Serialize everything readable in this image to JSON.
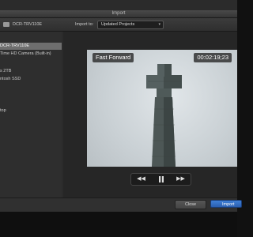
{
  "window": {
    "title": "Import"
  },
  "topbar": {
    "device_name": "DCR-TRV110E",
    "import_to_label": "Import to:",
    "import_to_value": "Updated Projects"
  },
  "sidebar": {
    "items": [
      {
        "label": "DCR-TRV110E",
        "selected": true
      },
      {
        "label": "Time HD Camera (Built-in)",
        "selected": false
      },
      {
        "label": "s 2TB",
        "selected": false
      },
      {
        "label": "ntosh SSD",
        "selected": false
      },
      {
        "label": "top",
        "selected": false
      }
    ]
  },
  "viewer": {
    "mode_label": "Fast Forward",
    "timecode": "00:02:19;23"
  },
  "transport": {
    "rewind_icon": "rewind-icon",
    "pause_icon": "pause-icon",
    "fastforward_icon": "fast-forward-icon"
  },
  "buttons": {
    "close_label": "Close",
    "import_label": "Import"
  },
  "colors": {
    "import_button": "#3370c8",
    "selection": "#6e6e6e"
  }
}
